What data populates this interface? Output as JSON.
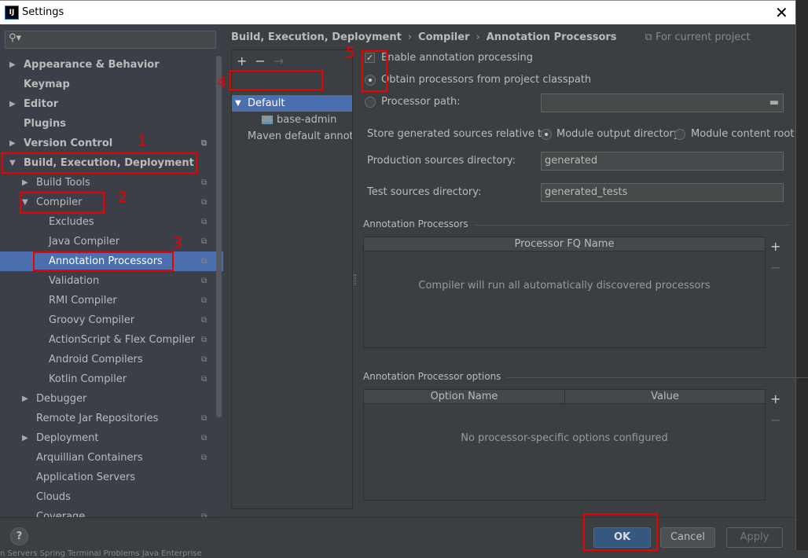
{
  "window": {
    "title": "Settings",
    "logo": "IJ"
  },
  "sidebar": {
    "items": [
      {
        "label": "Appearance & Behavior",
        "level": 0,
        "bold": true,
        "arrow": "right"
      },
      {
        "label": "Keymap",
        "level": 0,
        "bold": true
      },
      {
        "label": "Editor",
        "level": 0,
        "bold": true,
        "arrow": "right"
      },
      {
        "label": "Plugins",
        "level": 0,
        "bold": true
      },
      {
        "label": "Version Control",
        "level": 0,
        "bold": true,
        "arrow": "right",
        "copy": true
      },
      {
        "label": "Build, Execution, Deployment",
        "level": 0,
        "bold": true,
        "arrow": "down"
      },
      {
        "label": "Build Tools",
        "level": 1,
        "arrow": "right",
        "copy": true
      },
      {
        "label": "Compiler",
        "level": 1,
        "arrow": "down",
        "copy": true
      },
      {
        "label": "Excludes",
        "level": 2,
        "copy": true
      },
      {
        "label": "Java Compiler",
        "level": 2,
        "copy": true
      },
      {
        "label": "Annotation Processors",
        "level": 2,
        "copy": true,
        "selected": true
      },
      {
        "label": "Validation",
        "level": 2,
        "copy": true
      },
      {
        "label": "RMI Compiler",
        "level": 2,
        "copy": true
      },
      {
        "label": "Groovy Compiler",
        "level": 2,
        "copy": true
      },
      {
        "label": "ActionScript & Flex Compiler",
        "level": 2,
        "copy": true
      },
      {
        "label": "Android Compilers",
        "level": 2,
        "copy": true
      },
      {
        "label": "Kotlin Compiler",
        "level": 2,
        "copy": true
      },
      {
        "label": "Debugger",
        "level": 1,
        "arrow": "right"
      },
      {
        "label": "Remote Jar Repositories",
        "level": 1,
        "copy": true
      },
      {
        "label": "Deployment",
        "level": 1,
        "arrow": "right",
        "copy": true
      },
      {
        "label": "Arquillian Containers",
        "level": 1,
        "copy": true
      },
      {
        "label": "Application Servers",
        "level": 1
      },
      {
        "label": "Clouds",
        "level": 1
      },
      {
        "label": "Coverage",
        "level": 1,
        "copy": true
      }
    ]
  },
  "breadcrumb": {
    "items": [
      "Build, Execution, Deployment",
      "Compiler",
      "Annotation Processors"
    ],
    "scope": "For current project"
  },
  "profiles": {
    "toolbar": [
      "+",
      "−",
      "→"
    ],
    "rows": [
      "Default",
      "base-admin",
      "Maven default annotat"
    ]
  },
  "form": {
    "enable": {
      "label": "Enable annotation processing",
      "checked": true
    },
    "obtain": {
      "label": "Obtain processors from project classpath",
      "selected": true
    },
    "procpath": {
      "label": "Processor path:",
      "value": ""
    },
    "store": {
      "label": "Store generated sources relative to:",
      "opt1": "Module output directory",
      "opt2": "Module content root",
      "selected": "Module output directory"
    },
    "prod": {
      "label": "Production sources directory:",
      "value": "generated"
    },
    "test": {
      "label": "Test sources directory:",
      "value": "generated_tests"
    }
  },
  "processors": {
    "title": "Annotation Processors",
    "column": "Processor FQ Name",
    "empty": "Compiler will run all automatically discovered processors"
  },
  "options": {
    "title": "Annotation Processor options",
    "columns": [
      "Option Name",
      "Value"
    ],
    "empty": "No processor-specific options configured"
  },
  "footer": {
    "help": "?",
    "ok": "OK",
    "cancel": "Cancel",
    "apply": "Apply"
  },
  "taskbar": "n Servers    Spring    Terminal    Problems    Java Enterprise",
  "annotations": [
    "1",
    "2",
    "3",
    "4",
    "5"
  ],
  "colors": {
    "selection": "#4b6eaf",
    "ok": "#365880",
    "highlight": "#ee0000"
  }
}
